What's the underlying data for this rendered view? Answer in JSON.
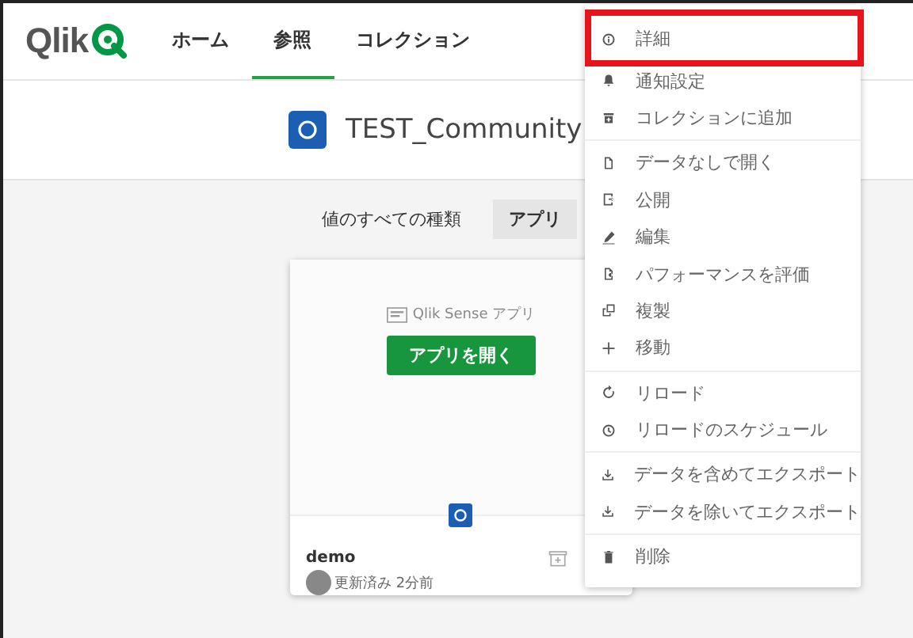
{
  "header": {
    "logo": "Qlik",
    "nav": [
      {
        "label": "ホーム",
        "selected": false
      },
      {
        "label": "参照",
        "selected": true
      },
      {
        "label": "コレクション",
        "selected": false
      }
    ]
  },
  "space": {
    "title": "TEST_Community"
  },
  "filters": [
    {
      "label": "値のすべての種類",
      "selected": false
    },
    {
      "label": "アプリ",
      "selected": true
    }
  ],
  "card": {
    "type_label": "Qlik Sense アプリ",
    "open_button": "アプリを開く",
    "name": "demo",
    "updated": "更新済み 2分前"
  },
  "menu": {
    "groups": [
      [
        {
          "label": "詳細",
          "highlighted": true
        },
        {
          "label": "通知設定",
          "highlighted": false
        },
        {
          "label": "コレクションに追加",
          "highlighted": false
        }
      ],
      [
        {
          "label": "データなしで開く",
          "highlighted": false
        },
        {
          "label": "公開",
          "highlighted": false
        },
        {
          "label": "編集",
          "highlighted": false
        },
        {
          "label": "パフォーマンスを評価",
          "highlighted": false
        },
        {
          "label": "複製",
          "highlighted": false
        },
        {
          "label": "移動",
          "highlighted": false
        }
      ],
      [
        {
          "label": "リロード",
          "highlighted": false
        },
        {
          "label": "リロードのスケジュール",
          "highlighted": false
        }
      ],
      [
        {
          "label": "データを含めてエクスポート",
          "highlighted": false
        },
        {
          "label": "データを除いてエクスポート",
          "highlighted": false
        }
      ],
      [
        {
          "label": "削除",
          "highlighted": false
        }
      ]
    ]
  }
}
